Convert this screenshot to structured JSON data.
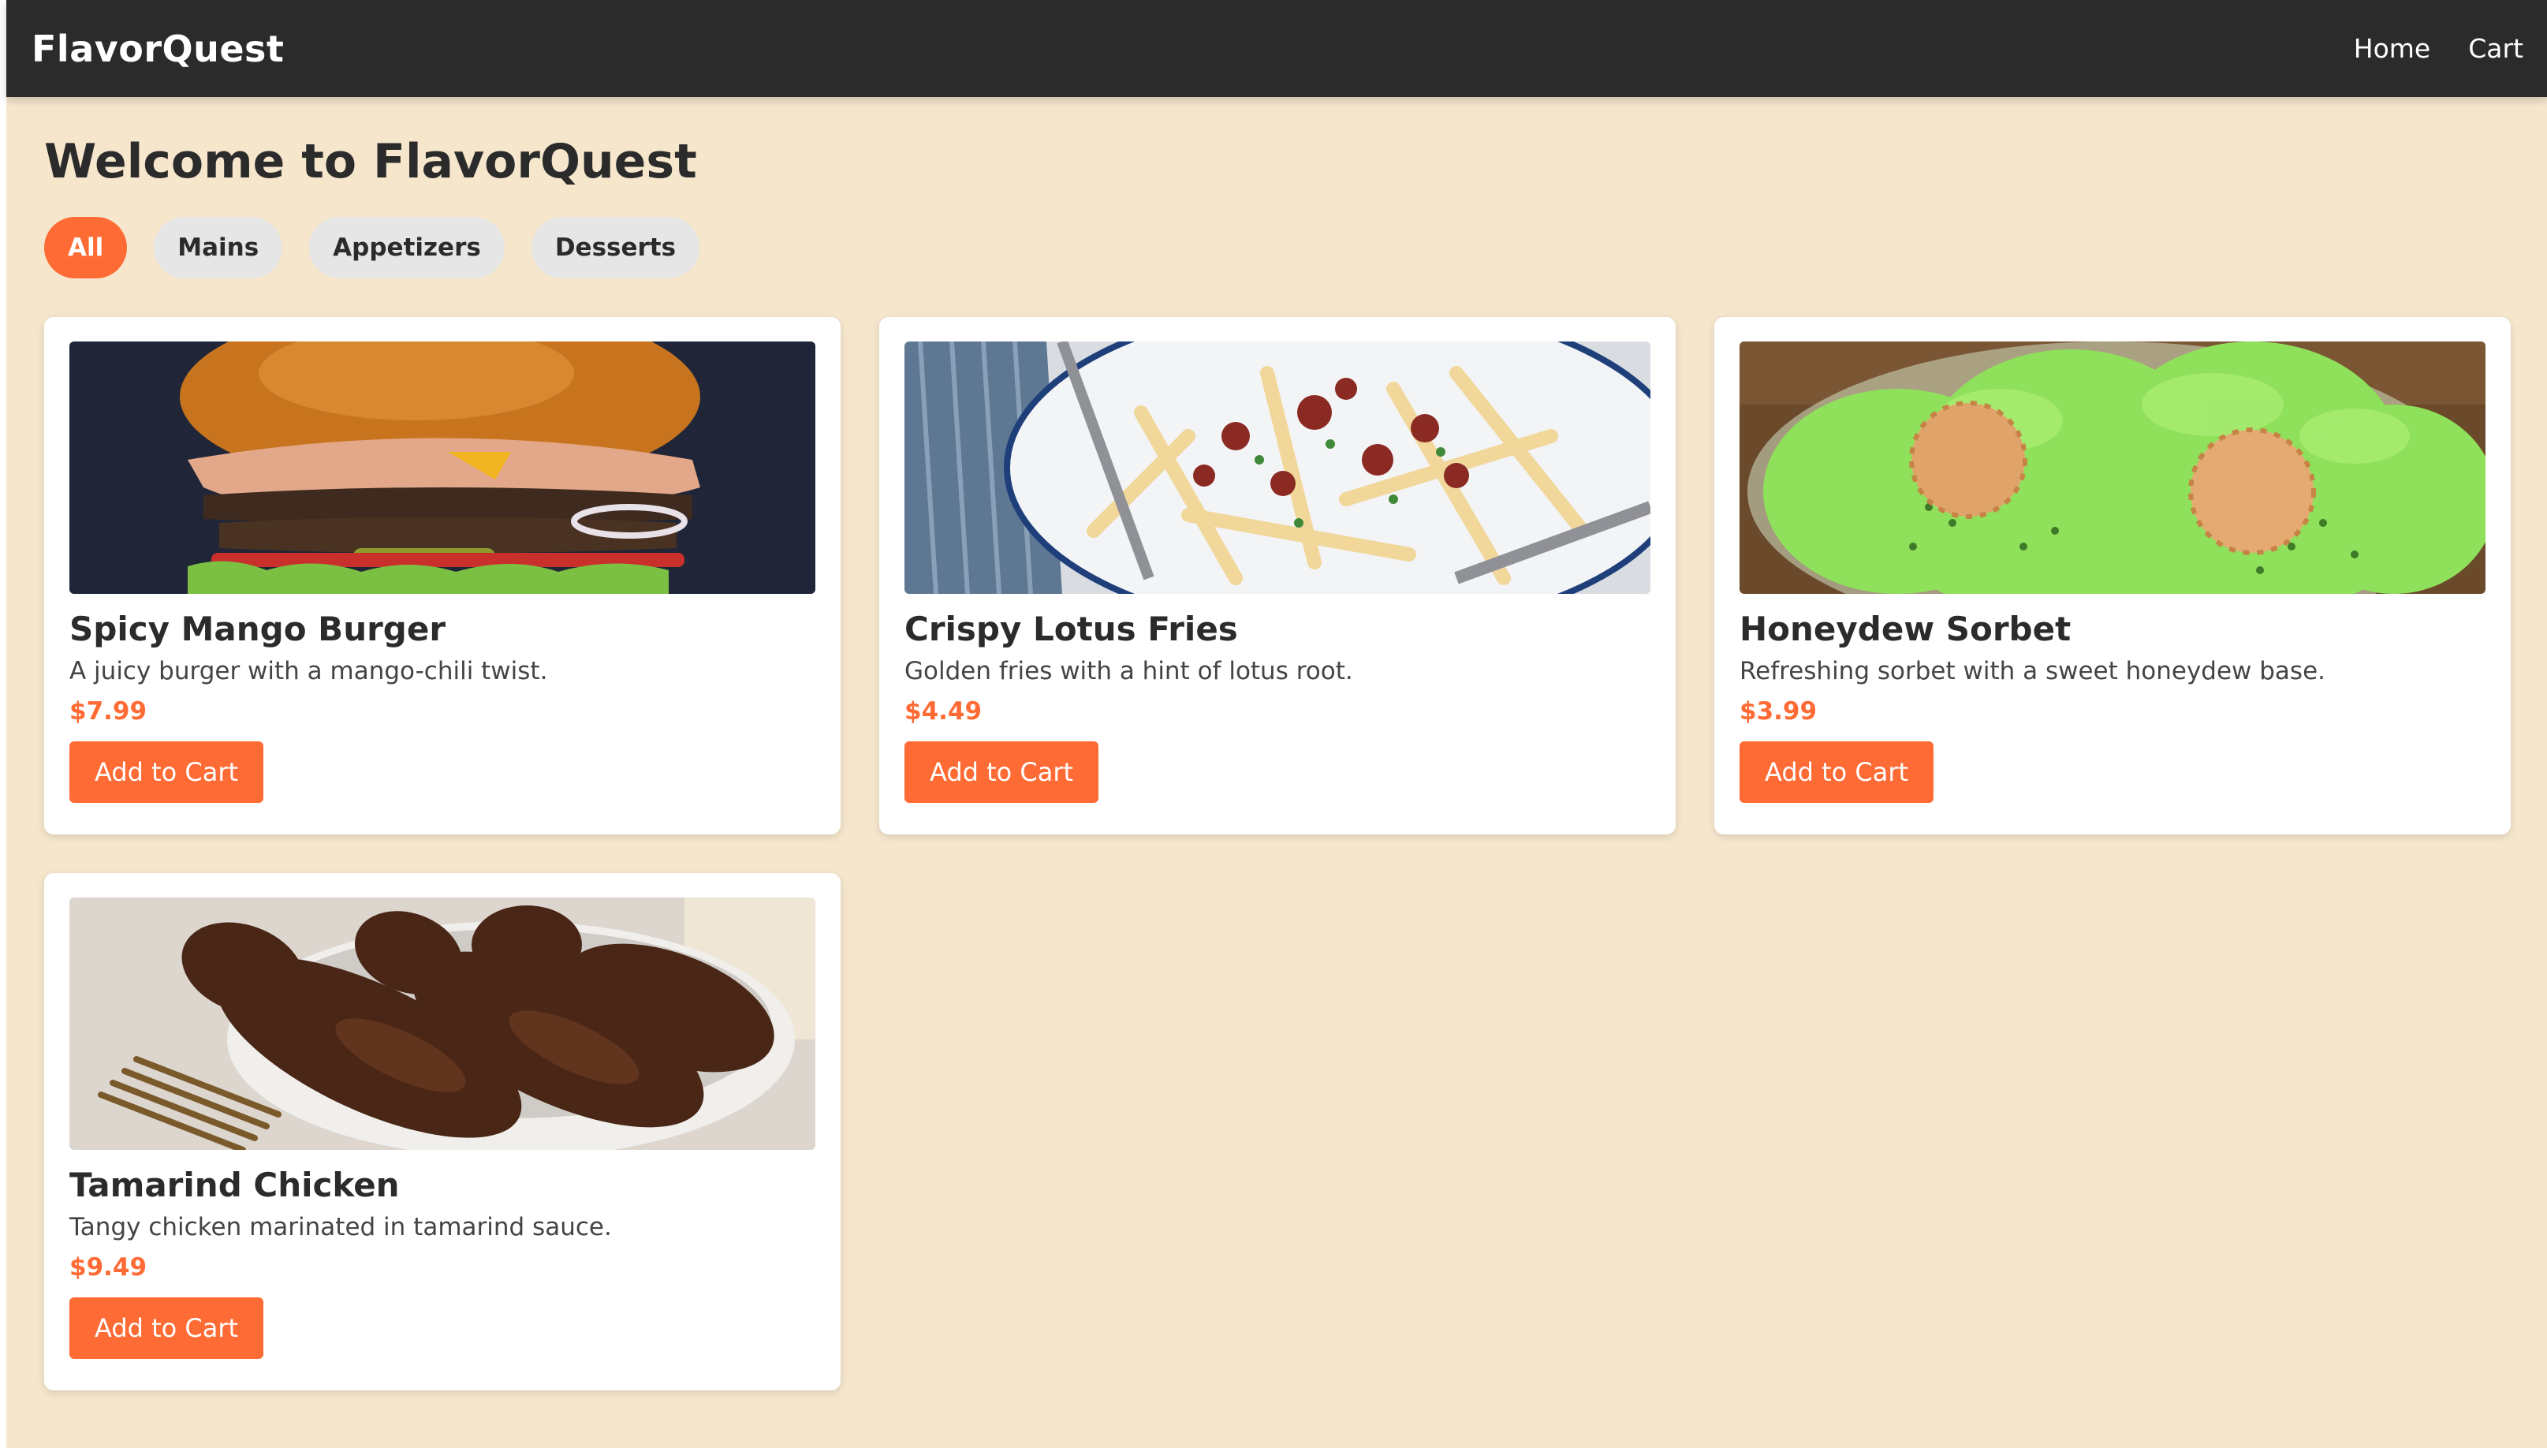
{
  "navbar": {
    "brand": "FlavorQuest",
    "links": [
      {
        "label": "Home"
      },
      {
        "label": "Cart"
      }
    ]
  },
  "main": {
    "title": "Welcome to FlavorQuest",
    "filters": [
      {
        "label": "All",
        "active": true
      },
      {
        "label": "Mains",
        "active": false
      },
      {
        "label": "Appetizers",
        "active": false
      },
      {
        "label": "Desserts",
        "active": false
      }
    ]
  },
  "items": [
    {
      "name": "Spicy Mango Burger",
      "description": "A juicy burger with a mango-chili twist.",
      "price": "$7.99",
      "button": "Add to Cart",
      "image": "burger-photo"
    },
    {
      "name": "Crispy Lotus Fries",
      "description": "Golden fries with a hint of lotus root.",
      "price": "$4.49",
      "button": "Add to Cart",
      "image": "fries-photo"
    },
    {
      "name": "Honeydew Sorbet",
      "description": "Refreshing sorbet with a sweet honeydew base.",
      "price": "$3.99",
      "button": "Add to Cart",
      "image": "sorbet-photo"
    },
    {
      "name": "Tamarind Chicken",
      "description": "Tangy chicken marinated in tamarind sauce.",
      "price": "$9.49",
      "button": "Add to Cart",
      "image": "chicken-photo"
    }
  ],
  "colors": {
    "accent": "#ff6b35",
    "navbar": "#2b2b2b",
    "page_background": "#f5e6cc",
    "card": "#ffffff",
    "filter_inactive": "#e6e6e6"
  }
}
